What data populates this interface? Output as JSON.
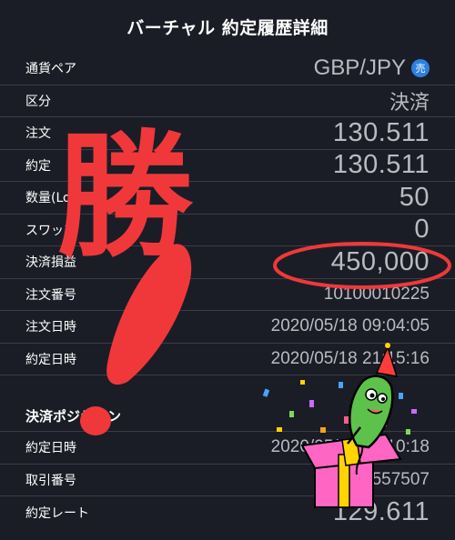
{
  "header": {
    "title": "バーチャル 約定履歴詳細"
  },
  "rows": [
    {
      "label": "通貨ペア",
      "value": "GBP/JPY",
      "badge": "売"
    },
    {
      "label": "区分",
      "value": "決済"
    },
    {
      "label": "注文",
      "value": "130.511"
    },
    {
      "label": "約定",
      "value": "130.511"
    },
    {
      "label": "数量(Lot)",
      "value": "50"
    },
    {
      "label": "スワップ",
      "value": "0"
    },
    {
      "label": "決済損益",
      "value": "450,000"
    },
    {
      "label": "注文番号",
      "value": "10100010225"
    },
    {
      "label": "注文日時",
      "value": "2020/05/18 09:04:05"
    },
    {
      "label": "約定日時",
      "value": "2020/05/18 21:15:16"
    }
  ],
  "section": {
    "title": "決済ポジション"
  },
  "section_rows": [
    {
      "label": "約定日時",
      "value": "2020/05/18 00:10:18"
    },
    {
      "label": "取引番号",
      "value": "101000557507"
    },
    {
      "label": "約定レート",
      "value": "129.611"
    }
  ],
  "annotation": {
    "text": "勝",
    "mark": "!"
  },
  "colors": {
    "background": "#1b1d26",
    "accent_red": "#f0383b",
    "badge_blue": "#2e7fe0"
  }
}
